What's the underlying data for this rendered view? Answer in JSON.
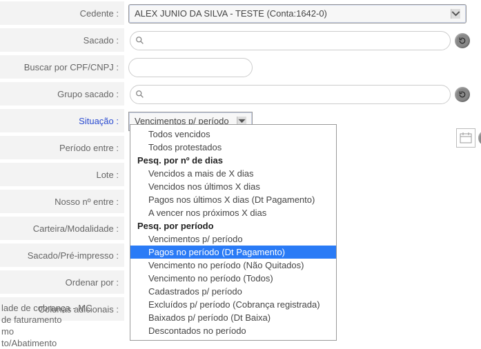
{
  "labels": {
    "cedente": "Cedente :",
    "sacado": "Sacado :",
    "buscarCpf": "Buscar por CPF/CNPJ :",
    "grupoSacado": "Grupo sacado :",
    "situacao": "Situação :",
    "periodo": "Período entre :",
    "lote": "Lote :",
    "nossoN": "Nosso nº entre :",
    "carteira": "Carteira/Modalidade :",
    "sacadoPre": "Sacado/Pré-impresso :",
    "ordenar": "Ordenar por :",
    "colunas": "Colunas adicionais :"
  },
  "cedente_value": "ALEX JUNIO DA SILVA - TESTE (Conta:1642-0)",
  "situacao_selected": "Vencimentos p/ período",
  "situacao_options": [
    {
      "type": "opt",
      "text": "Todos vencidos"
    },
    {
      "type": "opt",
      "text": "Todos protestados"
    },
    {
      "type": "hdr",
      "text": "Pesq. por nº de dias"
    },
    {
      "type": "opt",
      "text": "Vencidos a mais de X dias"
    },
    {
      "type": "opt",
      "text": "Vencidos nos últimos X dias"
    },
    {
      "type": "opt",
      "text": "Pagos nos últimos X dias (Dt Pagamento)"
    },
    {
      "type": "opt",
      "text": "A vencer nos próximos X dias"
    },
    {
      "type": "hdr",
      "text": "Pesq. por período"
    },
    {
      "type": "opt",
      "text": "Vencimentos p/ período"
    },
    {
      "type": "opt",
      "text": "Pagos no período (Dt Pagamento)",
      "selected": true
    },
    {
      "type": "opt",
      "text": "Vencimento no período (Não Quitados)"
    },
    {
      "type": "opt",
      "text": "Vencimento no período (Todos)"
    },
    {
      "type": "opt",
      "text": "Cadastrados p/ período"
    },
    {
      "type": "opt",
      "text": "Excluídos p/ período (Cobrança registrada)"
    },
    {
      "type": "opt",
      "text": "Baixados p/ período (Dt Baixa)"
    },
    {
      "type": "opt",
      "text": "Descontados no período"
    }
  ],
  "extras_lines": [
    "lade de cobrança - MC",
    "de faturamento",
    "mo",
    "to/Abatimento"
  ]
}
